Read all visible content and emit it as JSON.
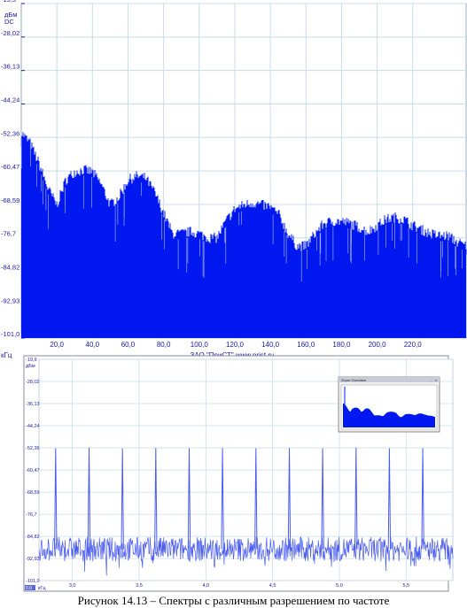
{
  "caption": "Рисунок 14.13 – Спектры с различным разрешением по частоте",
  "colors": {
    "trace": "#0018f0",
    "trace_light": "#4a5cf0",
    "grid": "#c8dce8",
    "text": "#1a1aa0"
  },
  "chart_data": [
    {
      "type": "area",
      "unit_top": "дБм",
      "mode_label": "DC",
      "ylim": [
        -101.0,
        -19.9
      ],
      "y_ticks": [
        "-19,9",
        "-28,02",
        "-36,13",
        "-44,24",
        "-52,36",
        "-60,47",
        "-68,59",
        "-76,7",
        "-84,82",
        "-92,93",
        "-101,0"
      ],
      "xlim": [
        0,
        250
      ],
      "x_ticks": [
        "20,0",
        "40,0",
        "60,0",
        "80,0",
        "100,0",
        "120,0",
        "140,0",
        "160,0",
        "180,0",
        "200,0",
        "220,0"
      ],
      "x_unit": "кГц",
      "footer": "ЗАО \"ПриСТ\"   www.prist.ru",
      "x": [
        0,
        5,
        10,
        15,
        20,
        25,
        30,
        35,
        40,
        45,
        50,
        55,
        60,
        65,
        70,
        75,
        80,
        85,
        90,
        95,
        100,
        105,
        110,
        115,
        120,
        125,
        130,
        135,
        140,
        145,
        150,
        155,
        160,
        165,
        170,
        175,
        180,
        185,
        190,
        195,
        200,
        205,
        210,
        215,
        220,
        225,
        230,
        235,
        240,
        245,
        250
      ],
      "y": [
        -52.5,
        -55,
        -60,
        -66,
        -70,
        -64,
        -62,
        -61.5,
        -62,
        -65,
        -70,
        -68,
        -64,
        -63,
        -63.5,
        -67,
        -72,
        -77,
        -77,
        -76.5,
        -77,
        -78,
        -78,
        -74,
        -71,
        -70,
        -69.5,
        -70,
        -70.5,
        -72.5,
        -77,
        -80,
        -80,
        -77,
        -74.5,
        -74,
        -74,
        -74.5,
        -75.5,
        -76.5,
        -75,
        -73.5,
        -73,
        -73.5,
        -75,
        -76,
        -77,
        -77.5,
        -77.5,
        -79,
        -80
      ]
    },
    {
      "type": "line",
      "unit_top": "дБм",
      "ylim": [
        -101.0,
        -19.9
      ],
      "y_ticks": [
        "-19,9",
        "-28,02",
        "-36,13",
        "-44,24",
        "-52,36",
        "-60,47",
        "-68,59",
        "-76,7",
        "-84,82",
        "-92,93",
        "-101,0"
      ],
      "xlim": [
        2.75,
        5.85
      ],
      "x_ticks": [
        "3,0",
        "3,5",
        "4,0",
        "4,5",
        "5,0",
        "5,5"
      ],
      "x_unit": "кГц",
      "x_corner_label": "0.0",
      "noise_level": -89.5,
      "noise_spread": 4.5,
      "peaks": {
        "x": [
          2.875,
          3.125,
          3.375,
          3.625,
          3.875,
          4.125,
          4.375,
          4.625,
          4.875,
          5.125,
          5.375,
          5.625
        ],
        "y": [
          -52.5,
          -52.3,
          -52.6,
          -52.4,
          -52.5,
          -52.4,
          -52.5,
          -52.4,
          -52.6,
          -52.3,
          -52.5,
          -52.4
        ]
      }
    }
  ],
  "inset": {
    "title": "Zoom Overview",
    "buttons": [
      "-",
      "x"
    ]
  }
}
